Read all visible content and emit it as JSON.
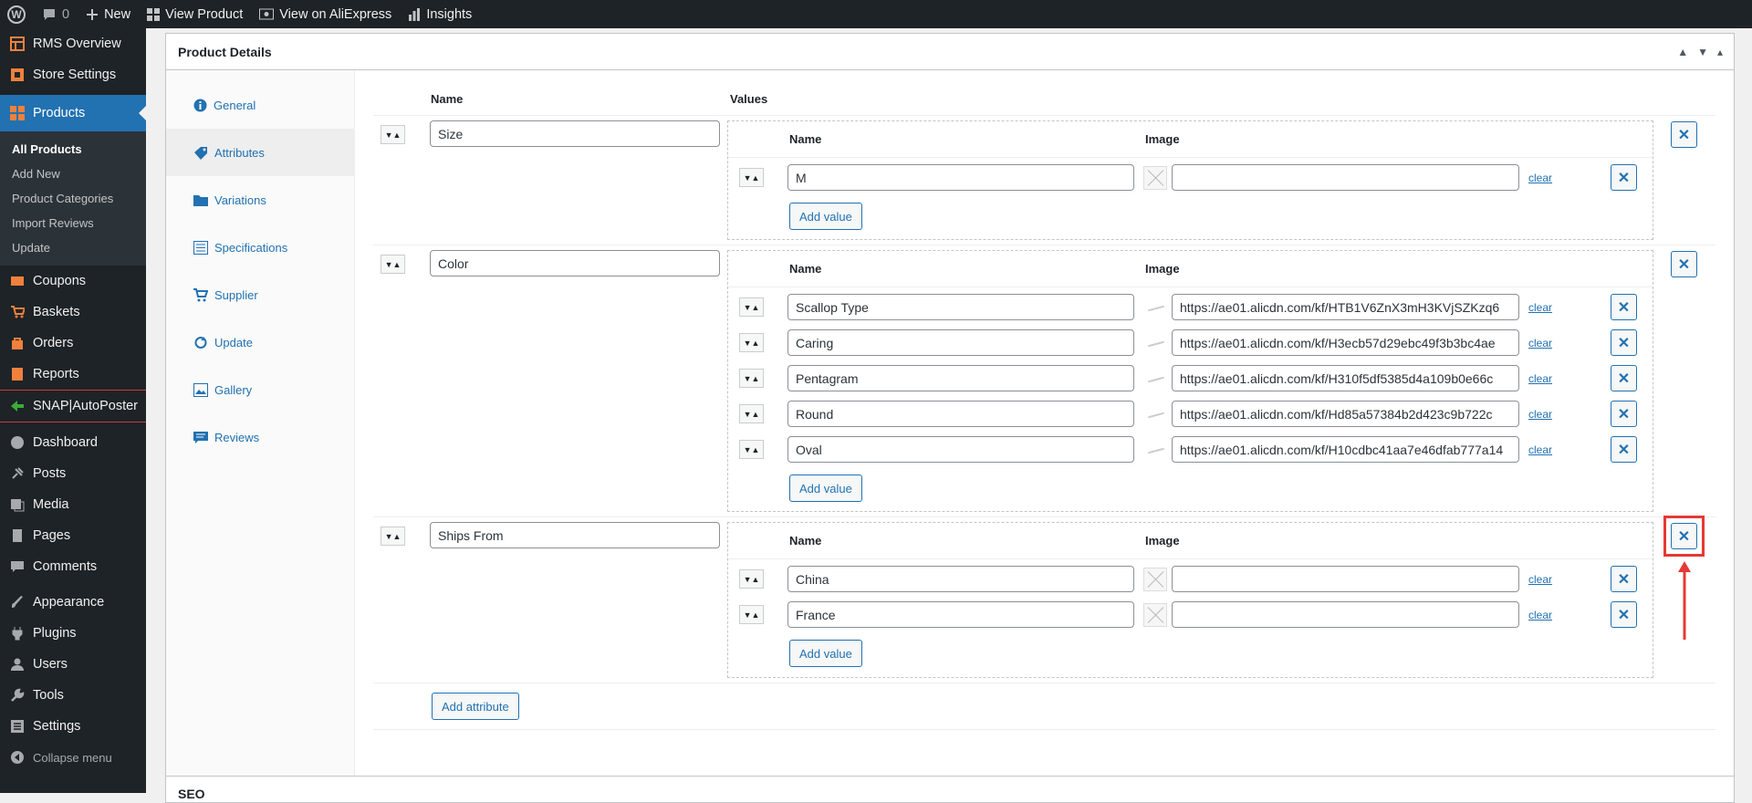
{
  "adminbar": {
    "comments_count": "0",
    "new_label": "New",
    "view_product": "View Product",
    "view_aliexpress": "View on AliExpress",
    "insights": "Insights"
  },
  "sidebar": {
    "top_items": [
      {
        "label": "RMS Overview",
        "icon": "table-icon"
      },
      {
        "label": "Store Settings",
        "icon": "settings-icon"
      }
    ],
    "products_label": "Products",
    "products_sub": [
      "All Products",
      "Add New",
      "Product Categories",
      "Import Reviews",
      "Update"
    ],
    "shop_items": [
      "Coupons",
      "Baskets",
      "Orders",
      "Reports"
    ],
    "snap_label": "SNAP|AutoPoster",
    "wp_items": [
      "Dashboard",
      "Posts",
      "Media",
      "Pages",
      "Comments",
      "Appearance",
      "Plugins",
      "Users",
      "Tools",
      "Settings"
    ],
    "collapse": "Collapse menu"
  },
  "postbox": {
    "title": "Product Details",
    "tabs": [
      "General",
      "Attributes",
      "Variations",
      "Specifications",
      "Supplier",
      "Update",
      "Gallery",
      "Reviews"
    ],
    "active_tab": "Attributes",
    "col_name": "Name",
    "col_values": "Values",
    "value_col_name": "Name",
    "value_col_image": "Image",
    "clear_label": "clear",
    "add_value_label": "Add value",
    "add_attribute_label": "Add attribute",
    "attributes": [
      {
        "name": "Size",
        "values": [
          {
            "name": "M",
            "image": "",
            "has_image": false
          }
        ]
      },
      {
        "name": "Color",
        "values": [
          {
            "name": "Scallop Type",
            "image": "https://ae01.alicdn.com/kf/HTB1V6ZnX3mH3KVjSZKzq6",
            "has_image": true
          },
          {
            "name": "Caring",
            "image": "https://ae01.alicdn.com/kf/H3ecb57d29ebc49f3b3bc4ae",
            "has_image": true
          },
          {
            "name": "Pentagram",
            "image": "https://ae01.alicdn.com/kf/H310f5df5385d4a109b0e66c",
            "has_image": true
          },
          {
            "name": "Round",
            "image": "https://ae01.alicdn.com/kf/Hd85a57384b2d423c9b722c",
            "has_image": true
          },
          {
            "name": "Oval",
            "image": "https://ae01.alicdn.com/kf/H10cdbc41aa7e46dfab777a14",
            "has_image": true
          }
        ]
      },
      {
        "name": "Ships From",
        "values": [
          {
            "name": "China",
            "image": "",
            "has_image": false
          },
          {
            "name": "France",
            "image": "",
            "has_image": false
          }
        ]
      }
    ]
  },
  "seo_title": "SEO",
  "colors": {
    "accent": "#2271b1",
    "highlight": "#e53935",
    "sidebar": "#1d2327"
  }
}
